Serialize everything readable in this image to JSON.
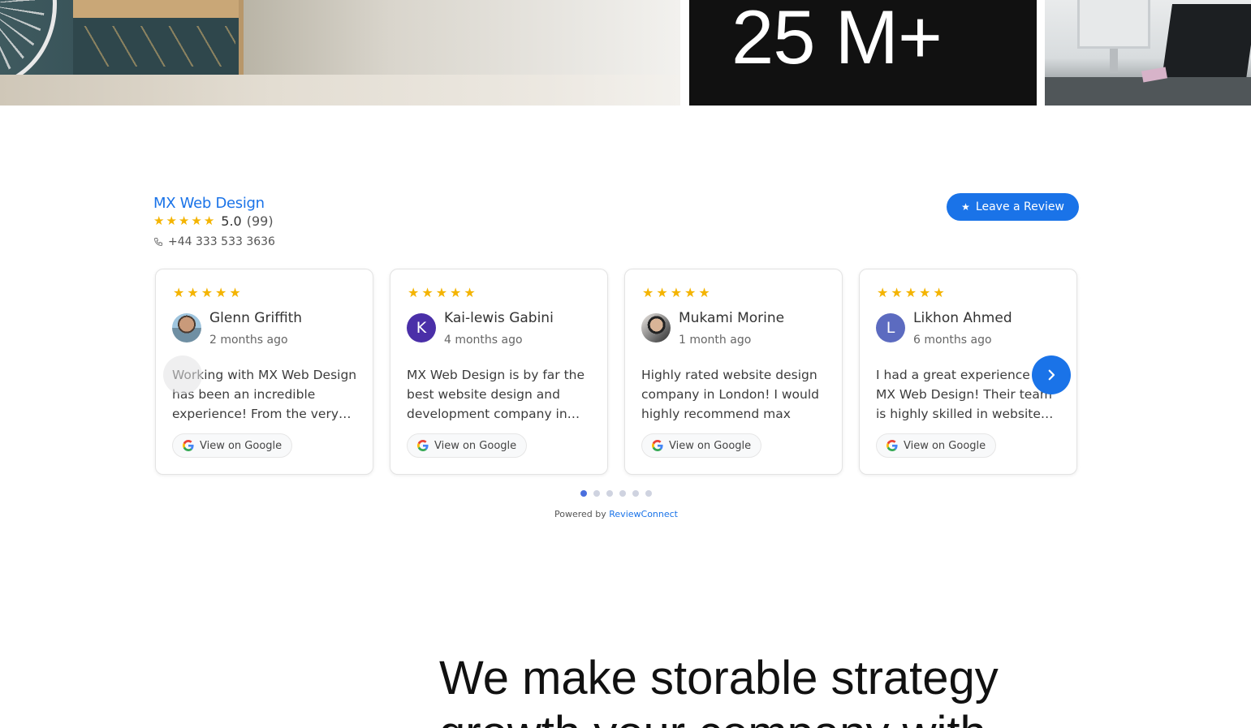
{
  "hero": {
    "stat_value": "25 M+"
  },
  "widget": {
    "business_name": "MX Web Design",
    "rating_value": "5.0",
    "rating_count": "(99)",
    "phone": "+44 333 533 3636",
    "leave_review_label": "Leave a Review",
    "star_glyph": "★",
    "view_on_google_label": "View on Google",
    "reviews": [
      {
        "name": "Glenn Griffith",
        "time": "2 months ago",
        "text": "Working with MX Web Design has been an incredible experience! From the very…",
        "avatar_letter": "",
        "avatar_type": "photo"
      },
      {
        "name": "Kai-lewis Gabini",
        "time": "4 months ago",
        "text": "MX Web Design is by far the best website design and development company in…",
        "avatar_letter": "K",
        "avatar_color": "#4a2fa8"
      },
      {
        "name": "Mukami Morine",
        "time": "1 month ago",
        "text": "Highly rated website design company in London! I would highly recommend max and…",
        "avatar_letter": "",
        "avatar_type": "photo"
      },
      {
        "name": "Likhon Ahmed",
        "time": "6 months ago",
        "text": "I had a great experience with MX Web Design! Their team is highly skilled in website…",
        "avatar_letter": "L",
        "avatar_color": "#5c6bc0"
      }
    ],
    "page_count": 6,
    "active_page": 1,
    "powered_by_prefix": "Powered by",
    "powered_by_brand": "ReviewConnect",
    "colors": {
      "accent": "#1a73e8",
      "star": "#f4b400"
    }
  },
  "section": {
    "headline_line1": "We make storable strategy",
    "headline_line2": "growth your company with"
  }
}
